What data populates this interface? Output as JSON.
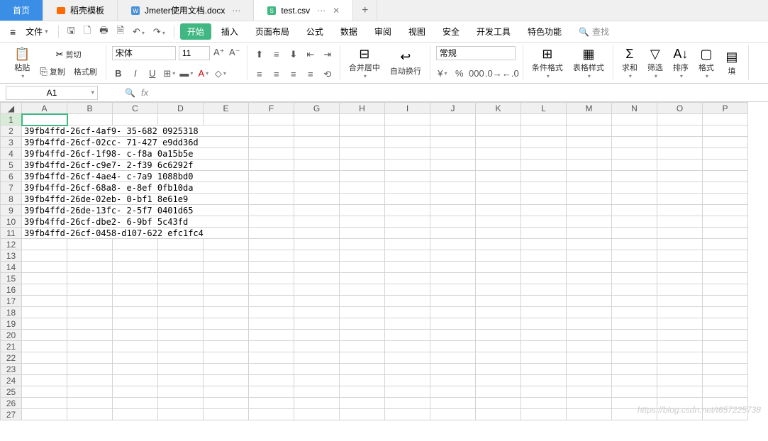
{
  "topTabs": {
    "home": "首页",
    "template": "稻壳模板",
    "doc": "Jmeter使用文档.docx",
    "csv": "test.csv"
  },
  "menuBar": {
    "file": "文件",
    "items": [
      "开始",
      "插入",
      "页面布局",
      "公式",
      "数据",
      "审阅",
      "视图",
      "安全",
      "开发工具",
      "特色功能"
    ],
    "search": "查找"
  },
  "ribbon": {
    "paste": "粘贴",
    "cut": "剪切",
    "copy": "复制",
    "fmtPainter": "格式刷",
    "fontName": "宋体",
    "fontSize": "11",
    "mergeCenter": "合并居中",
    "autoWrap": "自动换行",
    "numberFormat": "常规",
    "condFmt": "条件格式",
    "tableStyle": "表格样式",
    "sum": "求和",
    "filter": "筛选",
    "sort": "排序",
    "format": "格式",
    "fill": "填"
  },
  "nameBox": "A1",
  "columns": [
    "A",
    "B",
    "C",
    "D",
    "E",
    "F",
    "G",
    "H",
    "I",
    "J",
    "K",
    "L",
    "M",
    "N",
    "O",
    "P"
  ],
  "rowCount": 27,
  "cells": {
    "2": "39fb4ffd-26cf-4af9-    35-682   0925318",
    "3": "39fb4ffd-26cf-02cc-    71-427   e9dd36d",
    "4": "39fb4ffd-26cf-1f98-    c-f8a   0a15b5e",
    "5": "39fb4ffd-26cf-c9e7-    2-f39   6c6292f",
    "6": "39fb4ffd-26cf-4ae4-    c-7a9   1088bd0",
    "7": "39fb4ffd-26cf-68a8-    e-8ef   0fb10da",
    "8": "39fb4ffd-26de-02eb-    0-bf1   8e61e9",
    "9": "39fb4ffd-26de-13fc-    2-5f7   0401d65",
    "10": "39fb4ffd-26cf-dbe2-    6-9bf   5c43fd",
    "11": "39fb4ffd-26cf-0458-d107-622 efc1fc4"
  },
  "watermark": "https://blog.csdn.net/t657225738"
}
